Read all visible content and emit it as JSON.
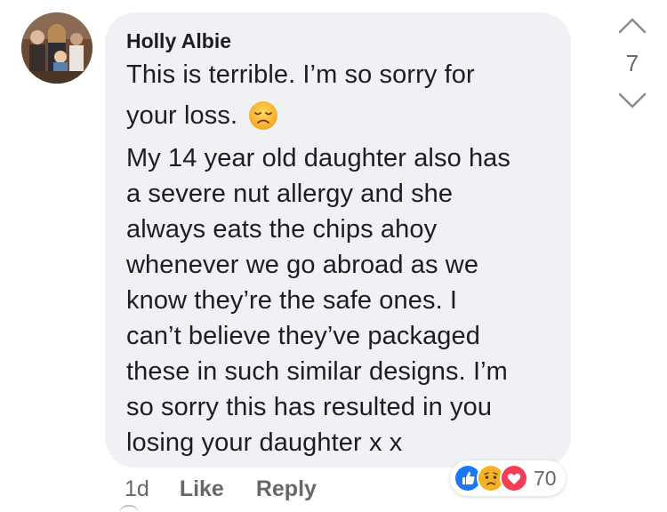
{
  "comment": {
    "author": "Holly Albie",
    "lines": [
      "This is terrible. I’m so sorry for",
      "your loss.",
      "My 14 year old daughter also has",
      "a severe nut allergy and she",
      "always eats the chips ahoy",
      "whenever we go abroad as we",
      "know they’re the safe ones. I",
      "can’t believe they’ve packaged",
      "these in such similar designs. I’m",
      "so sorry this has resulted in you",
      "losing your daughter x x"
    ],
    "inline_emoji": "disappointed-face-emoji"
  },
  "votes": {
    "count": "7"
  },
  "actions": {
    "time": "1d",
    "like_label": "Like",
    "reply_label": "Reply"
  },
  "reactions": {
    "icons": [
      "like-reaction-icon",
      "sad-reaction-icon",
      "love-reaction-icon"
    ],
    "count": "70"
  },
  "colors": {
    "bubble": "#f0f1f4",
    "text": "#1c1e21",
    "muted": "#65676b",
    "like_blue": "#1877f2",
    "love_red": "#f33e58",
    "sad_yellow": "#f7b125"
  }
}
